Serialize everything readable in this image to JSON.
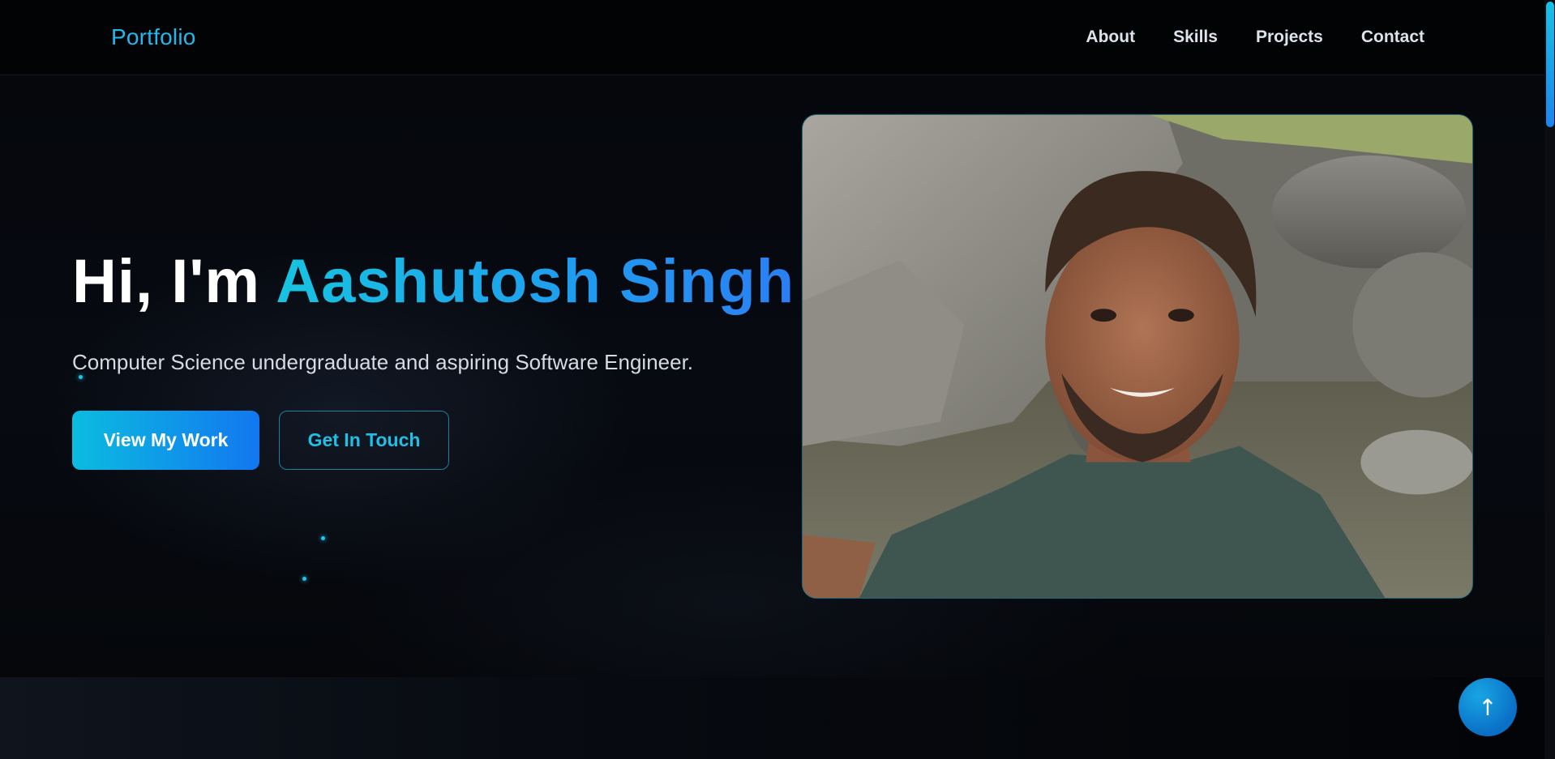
{
  "navbar": {
    "brand": "Portfolio",
    "links": [
      "About",
      "Skills",
      "Projects",
      "Contact"
    ]
  },
  "hero": {
    "greeting": "Hi, I'm ",
    "name": "Aashutosh Singh",
    "subtitle": "Computer Science undergraduate and aspiring Software Engineer.",
    "primary_button": "View My Work",
    "secondary_button": "Get In Touch",
    "photo_alt": "Portrait photo"
  },
  "scroll_top": {
    "icon": "arrow-up-icon",
    "symbol": "↑"
  },
  "colors": {
    "accent_cyan": "#17c4e0",
    "accent_blue": "#1277f0",
    "background": "#05070b",
    "text": "#e6edf3"
  }
}
